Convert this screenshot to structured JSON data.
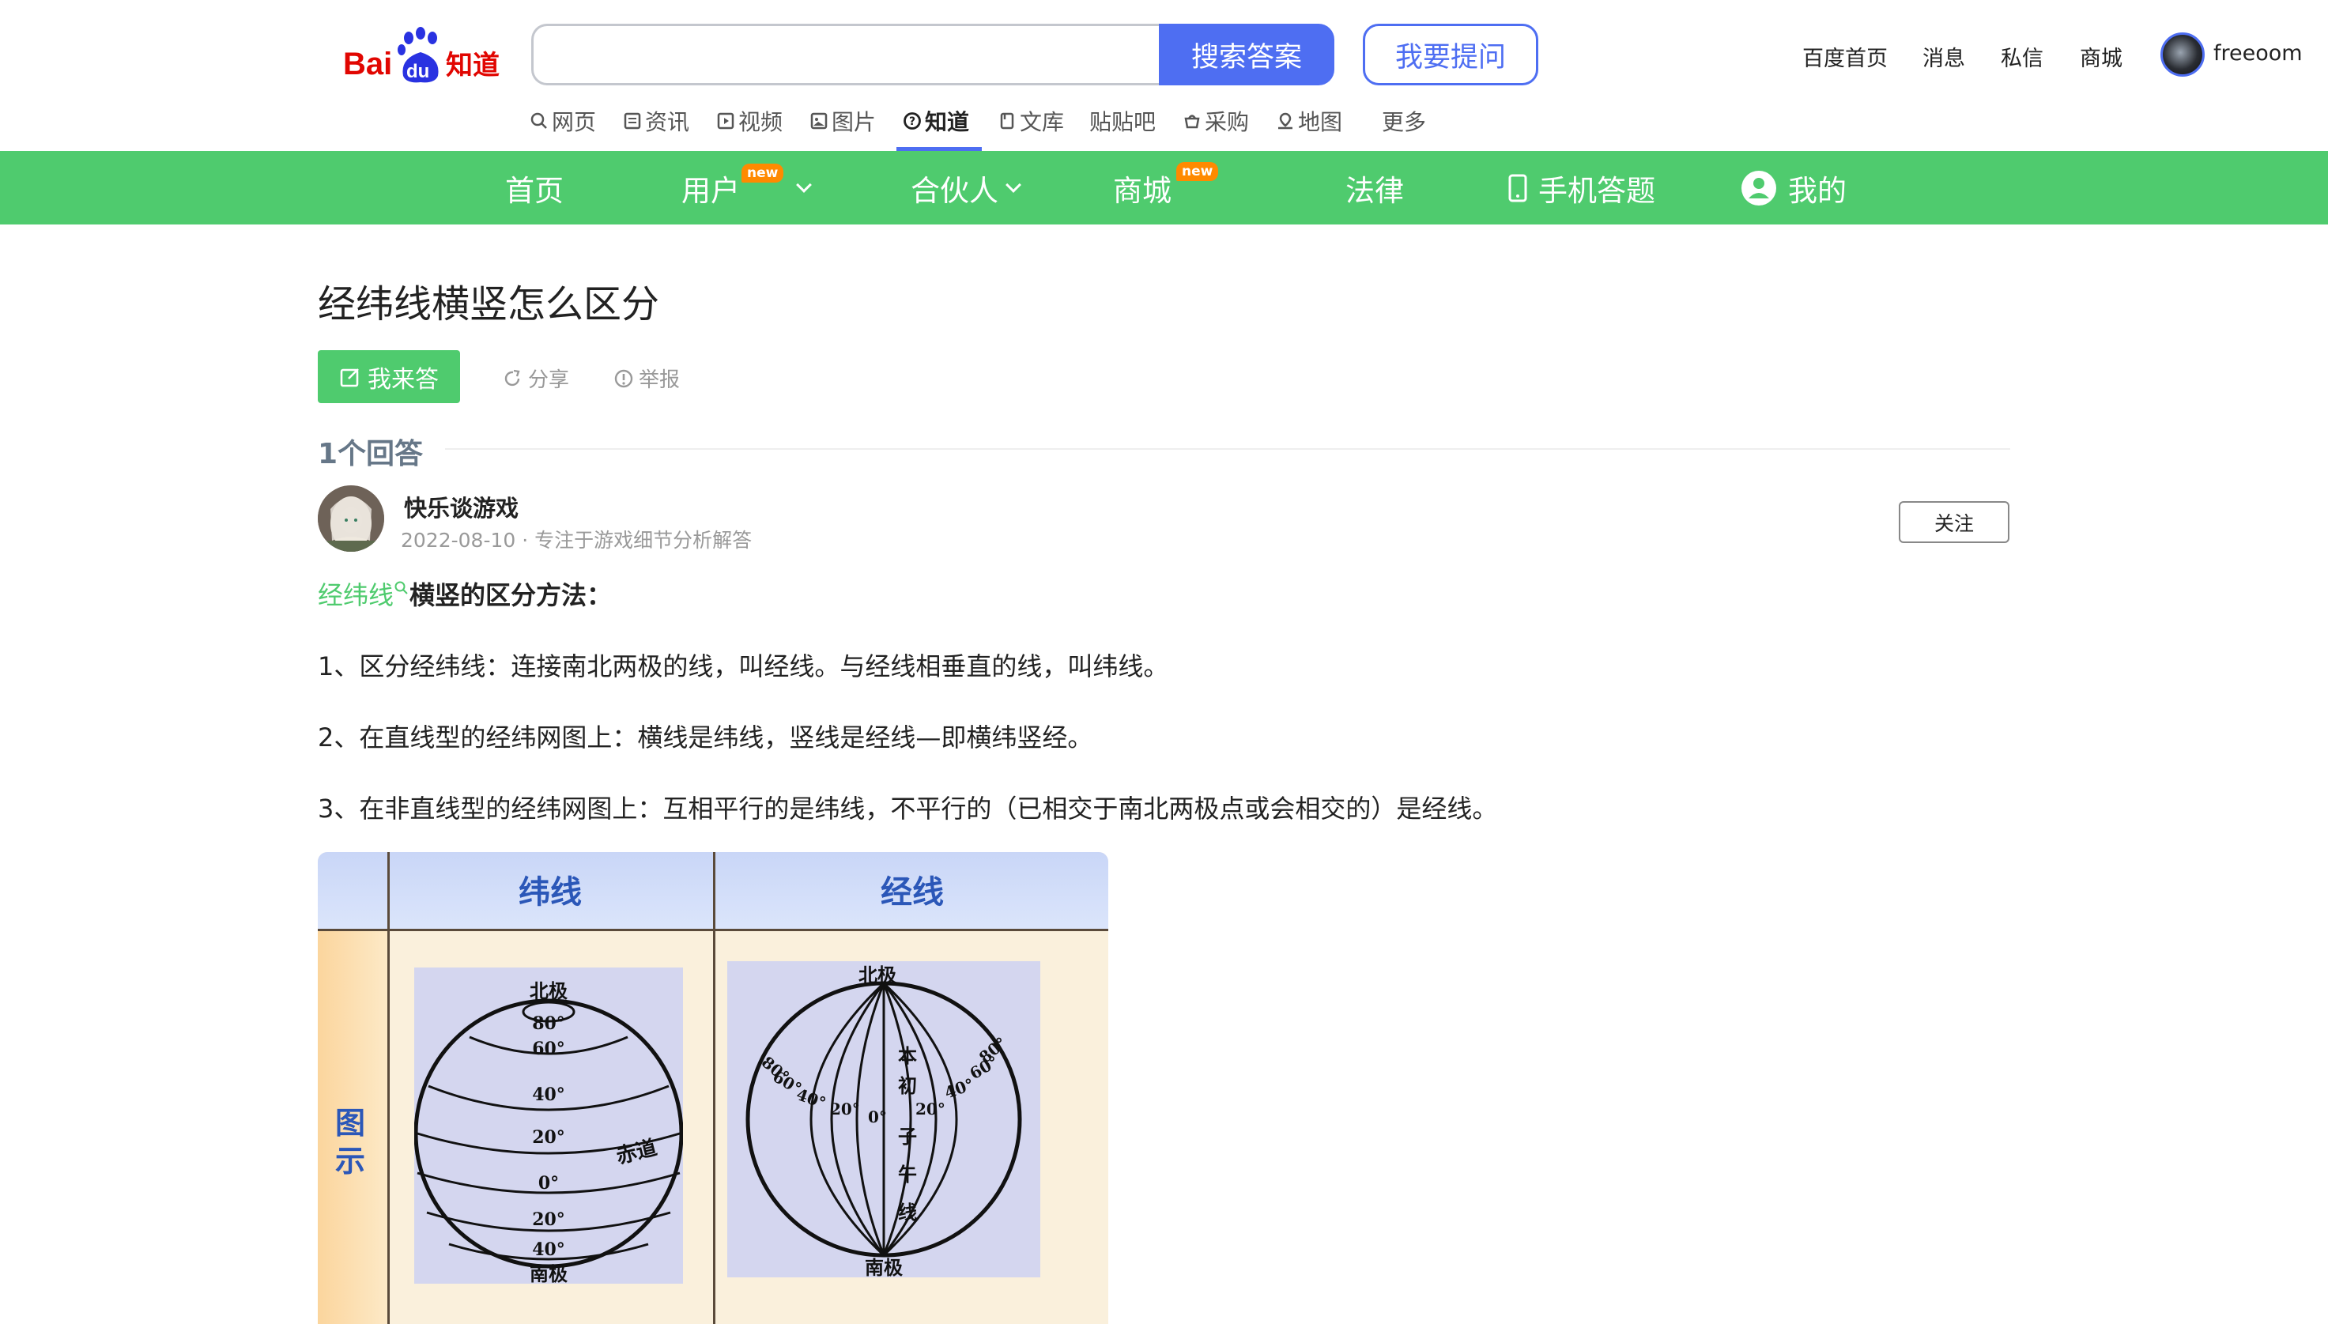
{
  "logo_text": {
    "bai": "Bai",
    "du": "du",
    "zhidao": "知道"
  },
  "search": {
    "value": "",
    "button": "搜索答案"
  },
  "ask_button": "我要提问",
  "top_links": [
    "百度首页",
    "消息",
    "私信",
    "商城"
  ],
  "user": {
    "name": "freeoom"
  },
  "subnav": [
    {
      "label": "网页",
      "icon": "search-icon"
    },
    {
      "label": "资讯",
      "icon": "news-icon"
    },
    {
      "label": "视频",
      "icon": "video-icon"
    },
    {
      "label": "图片",
      "icon": "image-icon"
    },
    {
      "label": "知道",
      "icon": "question-icon",
      "active": true
    },
    {
      "label": "文库",
      "icon": "doc-icon"
    },
    {
      "label": "贴贴吧",
      "icon": ""
    },
    {
      "label": "采购",
      "icon": "basket-icon"
    },
    {
      "label": "地图",
      "icon": "map-icon"
    },
    {
      "label": "更多",
      "icon": ""
    }
  ],
  "greennav": {
    "home": "首页",
    "user": "用户",
    "partner": "合伙人",
    "mall": "商城",
    "law": "法律",
    "mobile": "手机答题",
    "mine": "我的",
    "new_badge": "new"
  },
  "question": {
    "title": "经纬线横竖怎么区分",
    "answer_button": "我来答",
    "share": "分享",
    "report": "举报"
  },
  "answers_count": "1个回答",
  "answer": {
    "author": "快乐谈游戏",
    "meta": "2022-08-10 · 专注于游戏细节分析解答",
    "follow": "关注",
    "heading_keyword": "经纬线",
    "heading_rest": "横竖的区分方法：",
    "paragraphs": [
      "1、区分经纬线：连接南北两极的线，叫经线。与经线相垂直的线，叫纬线。",
      "2、在直线型的经纬网图上：横线是纬线，竖线是经线—即横纬竖经。",
      "3、在非直线型的经纬网图上：互相平行的是纬线，不平行的（已相交于南北两极点或会相交的）是经线。"
    ]
  },
  "figure": {
    "col1": "纬线",
    "col2": "经线",
    "row_label_1": "图",
    "row_label_2": "示",
    "globe1": {
      "north": "北极",
      "south": "南极",
      "labels": [
        "80°",
        "60°",
        "40°",
        "20°",
        "0°",
        "20°",
        "40°"
      ],
      "equator": "赤道"
    },
    "globe2": {
      "north": "北极",
      "south": "南极",
      "left_labels": [
        "80°",
        "60°",
        "40°",
        "20°"
      ],
      "right_labels": [
        "20°",
        "40°",
        "60°",
        "80°"
      ],
      "zero": "0°",
      "prime_meridian": [
        "本",
        "初",
        "子",
        "午",
        "线"
      ]
    }
  },
  "colors": {
    "brand_blue": "#4e6ef2",
    "green": "#4fcb6e",
    "badge_orange": "#ff8a00"
  }
}
